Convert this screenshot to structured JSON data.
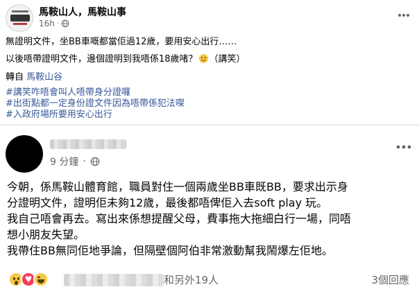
{
  "post": {
    "page_name": "馬鞍山人，馬鞍山事",
    "time": "16h",
    "separator": "·",
    "lines": [
      "無證明文件，坐BB車嘅都當佢過12歲，要用安心出行……",
      "以後唔帶證明文件，邊個證明到我唔係18歲啫？",
      "（講笑）"
    ],
    "shared_from_label": "轉自",
    "shared_from_link": "馬鞍山谷",
    "hashtags": [
      "#講笑咋唔會叫人唔帶身分證囉",
      "#出街點都一定身份證文件因為唔帶係犯法㗎",
      "#入政府場所要用安心出行"
    ]
  },
  "shared_card": {
    "time": "9 分鐘",
    "separator": "·",
    "lines": [
      "今朝，係馬鞍山體育館，職員對住一個兩歲坐BB車既BB，要求出示身",
      "分證明文件，證明佢未夠12歲，最後都唔俾佢入去soft play 玩。",
      "我自己唔會再去。寫出來係想提醒父母，費事拖大拖細白行一場，同唔",
      "想小朋友失望。",
      "我帶住BB無同佢地爭論，但隔壁個阿伯非常激動幫我鬧爆左佢地。"
    ],
    "reactions": [
      "wow-icon",
      "love-icon",
      "haha-icon"
    ],
    "reactors_suffix": "和另外19人",
    "comments": "3個回應"
  }
}
